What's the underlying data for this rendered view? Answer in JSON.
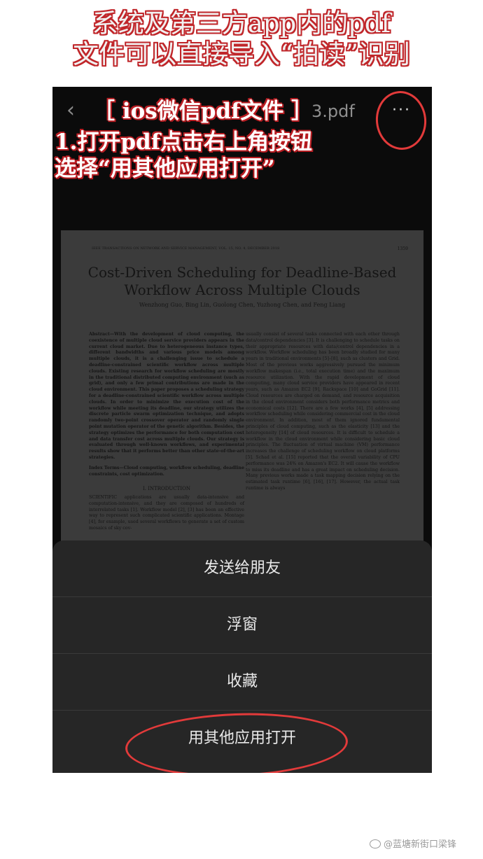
{
  "banner": {
    "line1": "系统及第三方app内的pdf",
    "line2": "文件可以直接导入“拍读”识别"
  },
  "annotation": {
    "line1": "［ ios微信pdf文件 ］",
    "line2": "1.打开pdf点击右上角按钮",
    "line3": "选择“用其他应用打开”"
  },
  "toolbar": {
    "back_glyph": "‹",
    "file_title": "3.pdf",
    "more_glyph": "···"
  },
  "document": {
    "header": "IEEE TRANSACTIONS ON NETWORK AND SERVICE MANAGEMENT, VOL. 15, NO. 4, DECEMBER 2018",
    "page_no": "1359",
    "title_line1": "Cost-Driven Scheduling for Deadline-Based",
    "title_line2": "Workflow Across Multiple Clouds",
    "authors": "Wenzhong Guo, Bing Lin, Guolong Chen, Yuzhong Chen, and Feng Liang",
    "abstract": "Abstract—With the development of cloud computing, the coexistence of multiple cloud service providers appears in the current cloud market. Due to heterogeneous instance types, different bandwidths and various price models among multiple clouds, it is a challenging issue to schedule a deadline-constrained scientific workflow across multiple clouds. Existing research for workflow scheduling are mostly in the traditional distributed computing environment (such as grid), and only a few primal contributions are made in the cloud environment. This paper proposes a scheduling strategy for a deadline-constrained scientific workflow across multiple clouds. In order to minimize the execution cost of the workflow while meeting its deadline, our strategy utilizes the discrete particle swarm optimization technique, and adopts randomly two-point crossover operator and randomly single point mutation operator of the genetic algorithm. Besides, the strategy optimizes the performance for both computation cost and data transfer cost across multiple clouds. Our strategy is evaluated through well-known workflows, and experimental results show that it performs better than other state-of-the-art strategies.",
    "index_terms": "Index Terms—Cloud computing, workflow scheduling, deadline constraints, cost optimization.",
    "intro_heading": "I. INTRODUCTION",
    "intro_text": "SCIENTIFIC applications are usually data-intensive and computation-intensive, and they are composed of hundreds of interrelated tasks [1]. Workflow model [2], [3] has been an effective way to represent such complicated scientific applications. Montage [4], for example, used several workflows to generate a set of custom mosaics of sky cov-",
    "right_column": "usually consist of several tasks connected with each other through data/control dependencies [3]. It is challenging to schedule tasks on their appropriate resources with data/control dependencies in a workflow. Workflow scheduling has been broadly studied for many years in traditional environments [5]–[8], such as clusters and Grid. Most of the previous works aggressively pursued the minimum workflow makespan (i.e., total execution time) and the maximum resource utilization. With the rapid development of cloud computing, many cloud service providers have appeared in recent years, such as Amazon EC2 [9], Rackspace [10] and GoGrid [11]. Cloud resources are charged on demand, and resource acquisition in the cloud environment considers both performance metrics and economical costs [12]. There are a few works [4], [5] addressing workflow scheduling while considering commercial cost in the cloud environment. In addition, most of them ignored fundamental principles of cloud computing, such as the elasticity [13] and the heterogeneity [14] of cloud resources. It is difficult to schedule a workflow in the cloud environment while considering basic cloud principles. The fluctuation of virtual machine (VM) performance increases the challenge of scheduling workflow on cloud platforms [5]. Schad et al. [15] reported that the overall variability of CPU performance was 24% on Amazon's EC2. It will cause the workflow to miss its deadline and has a great impact on scheduling decision. Many previous works made a task mapping decision relying on the estimated task runtime [6], [16], [17]. However, the actual task runtime is always"
  },
  "sheet": {
    "items": [
      {
        "label": "发送给朋友"
      },
      {
        "label": "浮窗"
      },
      {
        "label": "收藏"
      },
      {
        "label": "用其他应用打开"
      }
    ]
  },
  "watermark": "@蓝塘新街口梁锋",
  "colors": {
    "accent_red": "#e23a3a",
    "sheet_bg": "#262626",
    "phone_bg": "#0b0b0b"
  }
}
